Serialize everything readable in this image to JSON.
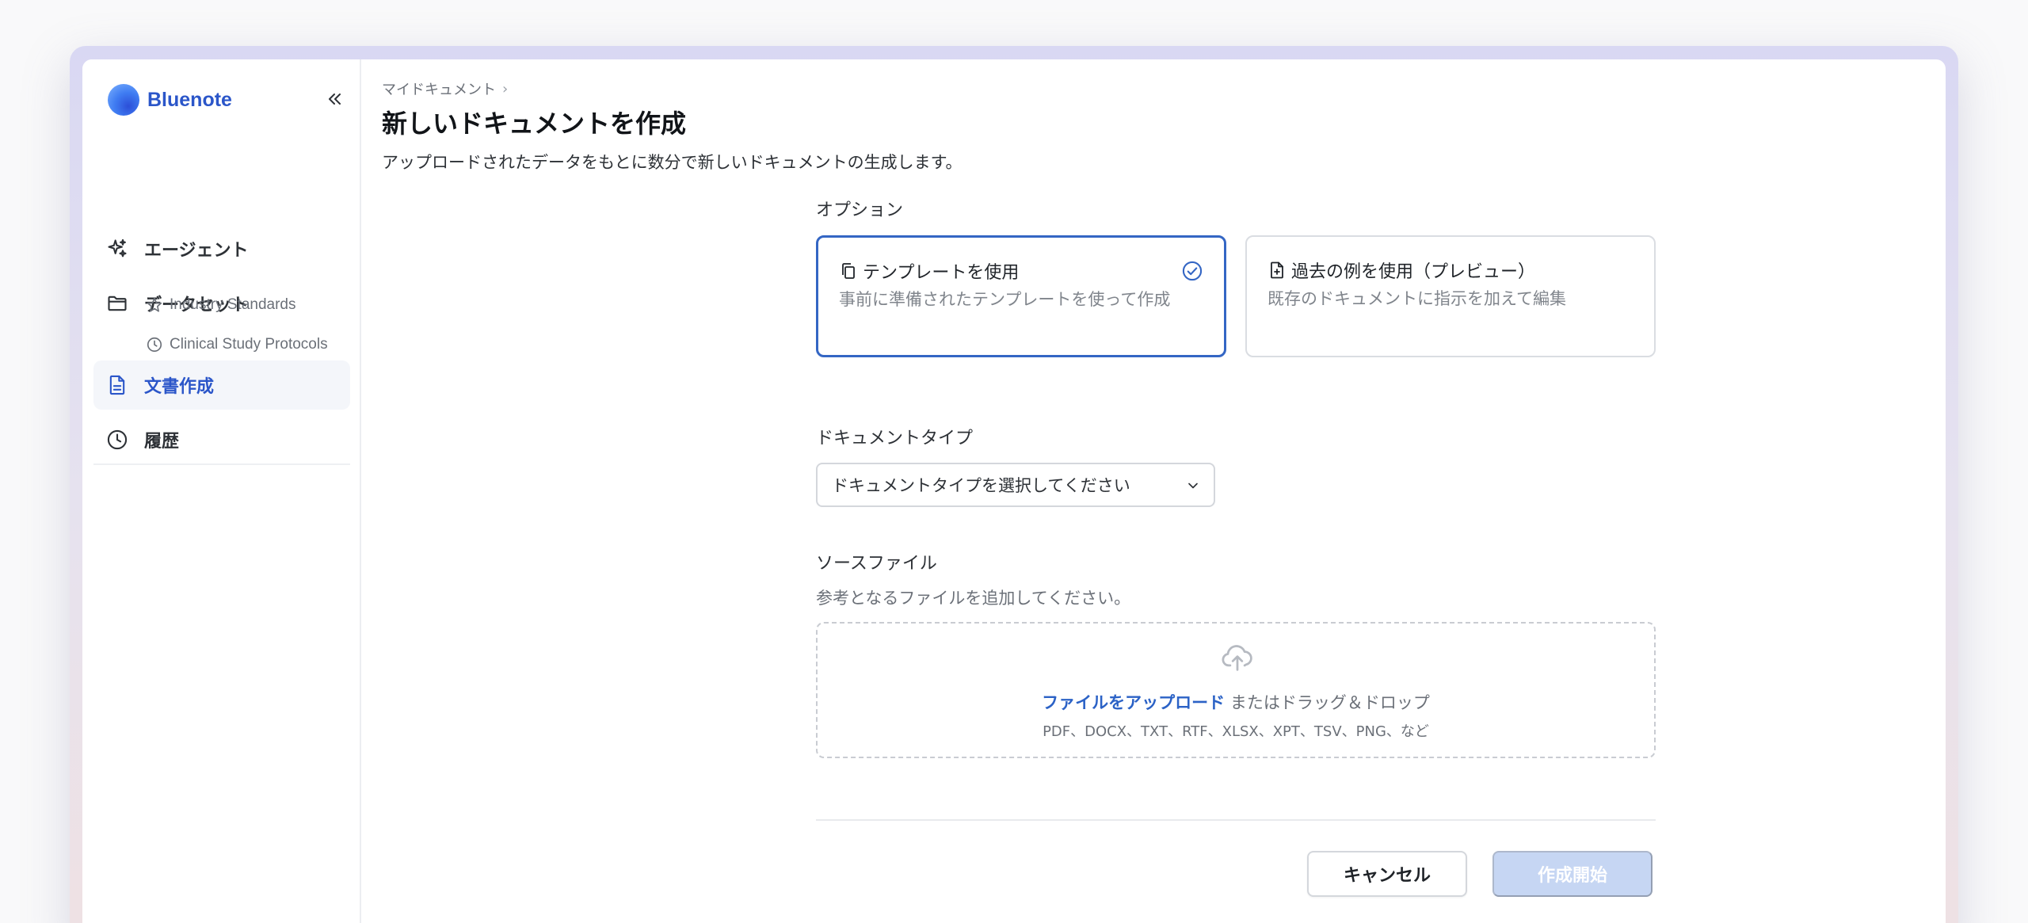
{
  "app": {
    "brand_name": "Bluenote",
    "brand_color": "#2b56c9"
  },
  "sidebar": {
    "collapse_icon": "double-chevron-left-icon",
    "items": [
      {
        "label": "エージェント",
        "icon": "sparkles-icon"
      },
      {
        "label": "データセット",
        "icon": "folder-icon"
      },
      {
        "label": "文書作成",
        "icon": "document-icon",
        "active": true
      },
      {
        "label": "履歴",
        "icon": "clock-icon"
      }
    ],
    "dataset_children": [
      {
        "label": "Industry Standards",
        "icon": "star-icon"
      },
      {
        "label": "Clinical Study Protocols",
        "icon": "clock-icon"
      }
    ]
  },
  "header": {
    "breadcrumb": "マイドキュメント",
    "breadcrumb_separator": "›",
    "title": "新しいドキュメントを作成",
    "description": "アップロードされたデータをもとに数分で新しいドキュメントの生成します。"
  },
  "options": {
    "label": "オプション",
    "cards": [
      {
        "title": "テンプレートを使用",
        "description": "事前に準備されたテンプレートを使って作成",
        "selected": true,
        "icon": "copy-icon"
      },
      {
        "title": "過去の例を使用（プレビュー）",
        "description": "既存のドキュメントに指示を加えて編集",
        "selected": false,
        "icon": "file-plus-icon"
      }
    ]
  },
  "document_type": {
    "label": "ドキュメントタイプ",
    "placeholder": "ドキュメントタイプを選択してください"
  },
  "source_files": {
    "label": "ソースファイル",
    "description": "参考となるファイルを追加してください。",
    "upload_link": "ファイルをアップロード",
    "upload_suffix": " またはドラッグ＆ドロップ",
    "formats": "PDF、DOCX、TXT、RTF、XLSX、XPT、TSV、PNG、など"
  },
  "actions": {
    "cancel_label": "キャンセル",
    "submit_label": "作成開始",
    "submit_disabled": true
  }
}
